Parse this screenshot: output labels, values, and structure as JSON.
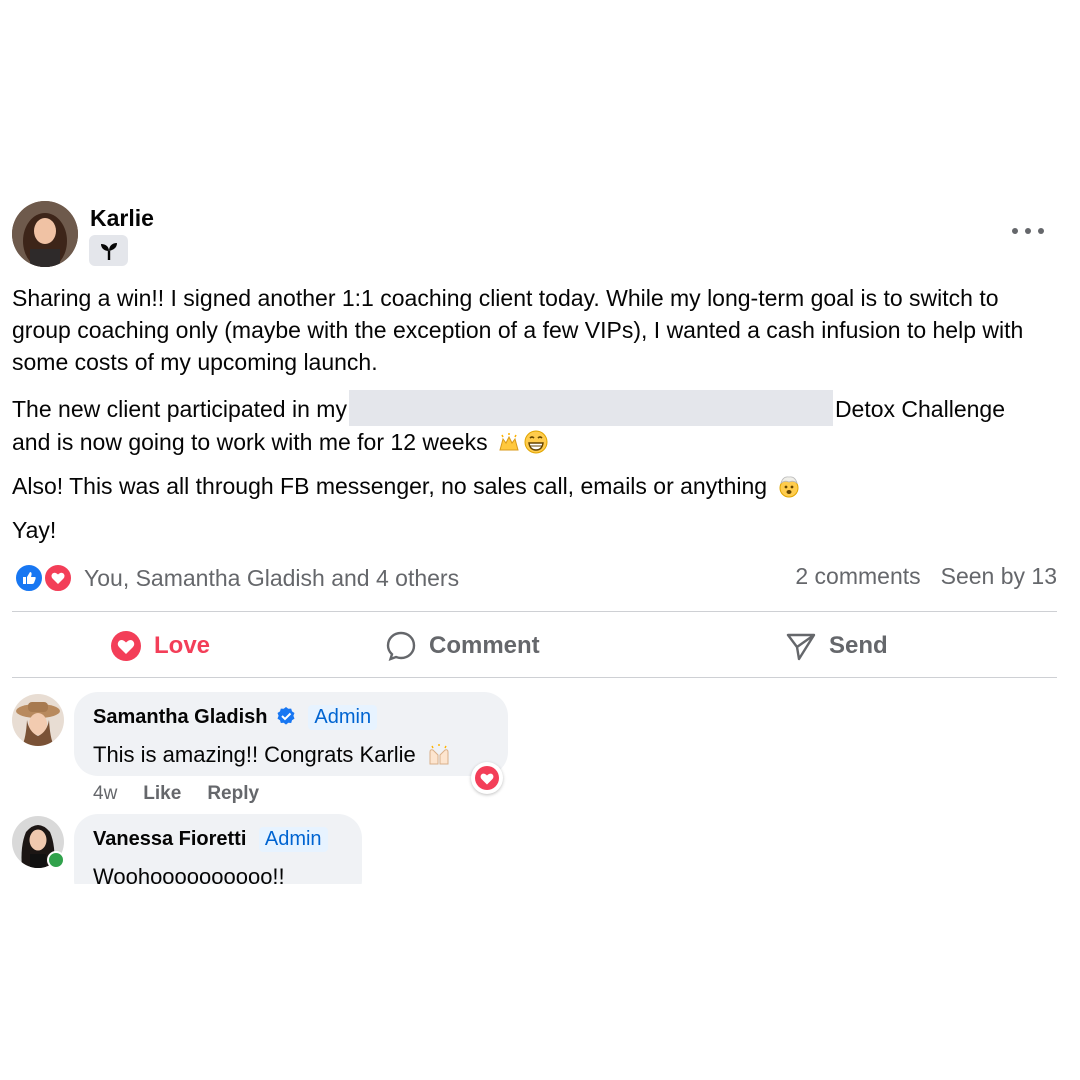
{
  "post": {
    "author": "Karlie",
    "badge_icon": "sprout-icon",
    "paragraphs": {
      "p1": "Sharing a win!! I signed another 1:1 coaching client today. While my long-term goal is to switch to group coaching only (maybe with the exception of a few VIPs), I wanted a cash infusion to help with some costs of my upcoming launch.",
      "p2_before": "The new client participated in my",
      "p2_after": "Detox Challenge",
      "p2_line2": "and is now going to work with me for 12 weeks",
      "p3": "Also! This was all through FB messenger, no sales call, emails or anything",
      "p4": "Yay!"
    },
    "emojis": [
      "raising-hands-emoji",
      "grinning-emoji",
      "exploding-head-emoji"
    ]
  },
  "reactions": {
    "names": "You, Samantha Gladish and 4 others",
    "comments_count": "2 comments",
    "seen_by": "Seen by 13"
  },
  "actions": {
    "love": "Love",
    "comment": "Comment",
    "send": "Send"
  },
  "comments": [
    {
      "name": "Samantha Gladish",
      "verified": true,
      "role": "Admin",
      "text": "This is amazing!! Congrats Karlie",
      "time": "4w",
      "like": "Like",
      "reply": "Reply"
    },
    {
      "name": "Vanessa Fioretti",
      "role": "Admin",
      "text": "Woohoooooooooo!!"
    }
  ],
  "colors": {
    "love": "#f33e58",
    "like": "#1877f2",
    "admin": "#0064d1",
    "muted": "#65676b",
    "online": "#31a24c"
  }
}
